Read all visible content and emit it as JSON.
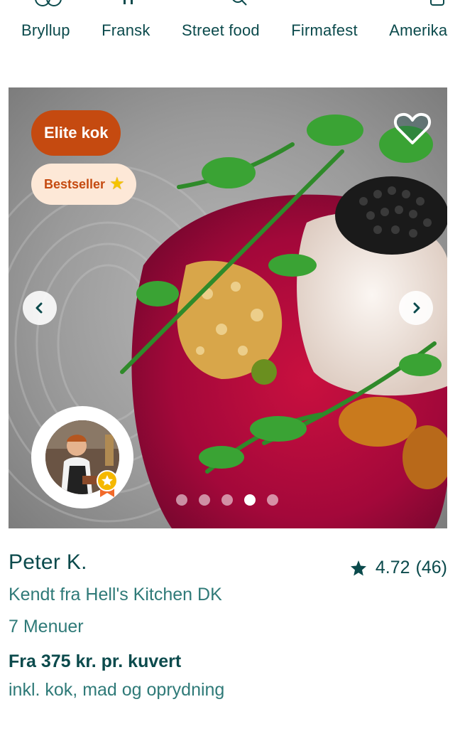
{
  "categories": [
    "Bryllup",
    "Fransk",
    "Street food",
    "Firmafest",
    "Amerika"
  ],
  "card": {
    "badges": {
      "elite": "Elite kok",
      "bestseller": "Bestseller"
    },
    "carousel": {
      "total_slides": 5,
      "active_slide": 4
    }
  },
  "chef": {
    "name": "Peter K.",
    "subtitle": "Kendt fra Hell's Kitchen DK",
    "menus": "7 Menuer",
    "price": "Fra 375 kr. pr. kuvert",
    "included": "inkl. kok, mad og oprydning",
    "rating": "4.72",
    "review_count": "(46)"
  },
  "colors": {
    "primary_text": "#0b4a4c",
    "secondary_text": "#2f7a78",
    "elite_badge": "#c54a10",
    "bestseller_badge_bg": "#fde8d7"
  },
  "icons": {
    "favorite": "heart-icon",
    "prev": "chevron-left-icon",
    "next": "chevron-right-icon",
    "rating": "star-icon",
    "bestseller": "star-icon",
    "chef_award": "medal-icon"
  }
}
